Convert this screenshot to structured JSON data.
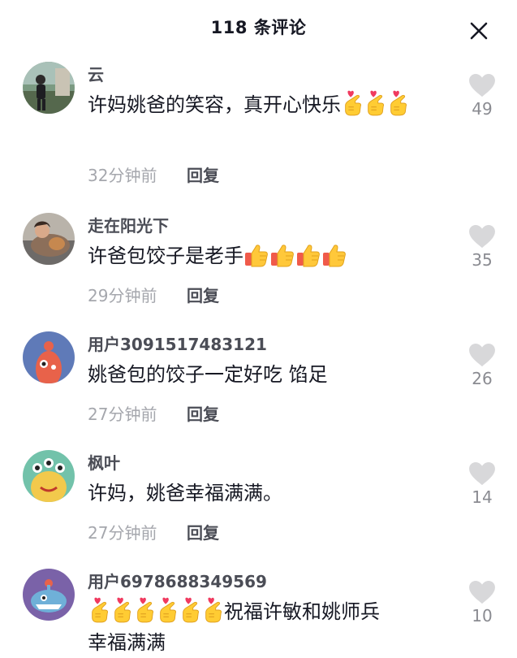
{
  "header": {
    "title": "118 条评论",
    "close_icon": "close-icon"
  },
  "comments": [
    {
      "username": "云",
      "text": "许妈姚爸的笑容，真开心快乐",
      "emoji": "finger-heart-emoji",
      "emoji_count": 3,
      "time": "32分钟前",
      "reply": "回复",
      "likes": "49"
    },
    {
      "username": "走在阳光下",
      "text": "许爸包饺子是老手",
      "emoji": "thumbs-up-emoji",
      "emoji_count": 4,
      "time": "29分钟前",
      "reply": "回复",
      "likes": "35"
    },
    {
      "username": "用户3091517483121",
      "text": "姚爸包的饺子一定好吃 馅足",
      "time": "27分钟前",
      "reply": "回复",
      "likes": "26"
    },
    {
      "username": "枫叶",
      "text": "许妈，姚爸幸福满满。",
      "time": "27分钟前",
      "reply": "回复",
      "likes": "14"
    },
    {
      "username": "用户6978688349569",
      "emoji": "finger-heart-emoji",
      "emoji_count": 6,
      "text": "祝福许敏和姚师兵",
      "text_line2": "幸福满满",
      "likes": "10"
    }
  ],
  "colors": {
    "text": "#161823",
    "username": "#4b4d56",
    "meta": "#a5a7ad",
    "heart": "#d8d8da"
  }
}
